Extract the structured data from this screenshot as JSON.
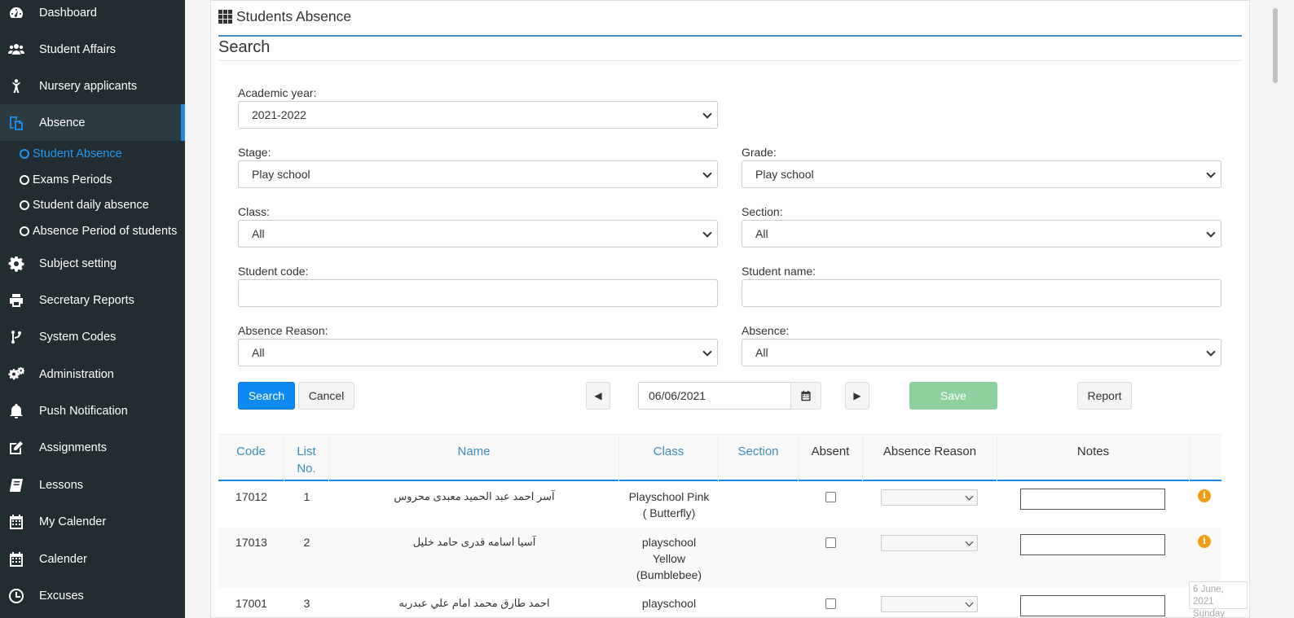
{
  "sidebar": {
    "items": [
      {
        "label": "Dashboard",
        "icon": "dashboard-icon"
      },
      {
        "label": "Student Affairs",
        "icon": "users-icon"
      },
      {
        "label": "Nursery applicants",
        "icon": "child-icon"
      },
      {
        "label": "Absence",
        "icon": "copy-icon",
        "active": true
      },
      {
        "label": "Subject setting",
        "icon": "gear-icon"
      },
      {
        "label": "Secretary Reports",
        "icon": "print-icon"
      },
      {
        "label": "System Codes",
        "icon": "code-fork-icon"
      },
      {
        "label": "Administration",
        "icon": "gears-icon"
      },
      {
        "label": "Push Notification",
        "icon": "bell-icon"
      },
      {
        "label": "Assignments",
        "icon": "edit-icon"
      },
      {
        "label": "Lessons",
        "icon": "book-icon"
      },
      {
        "label": "My Calender",
        "icon": "calendar-icon"
      },
      {
        "label": "Calender",
        "icon": "calendar-icon"
      },
      {
        "label": "Excuses",
        "icon": "clock-icon"
      }
    ],
    "subitems": [
      {
        "label": "Student Absence",
        "active": true
      },
      {
        "label": "Exams Periods"
      },
      {
        "label": "Student daily absence"
      },
      {
        "label": "Absence Period of students"
      }
    ]
  },
  "page": {
    "title": "Students Absence",
    "search_title": "Search"
  },
  "form": {
    "academic_year": {
      "label": "Academic year:",
      "value": "2021-2022"
    },
    "stage": {
      "label": "Stage:",
      "value": "Play school"
    },
    "grade": {
      "label": "Grade:",
      "value": "Play school"
    },
    "class": {
      "label": "Class:",
      "value": "All"
    },
    "section": {
      "label": "Section:",
      "value": "All"
    },
    "student_code": {
      "label": "Student code:",
      "value": ""
    },
    "student_name": {
      "label": "Student name:",
      "value": ""
    },
    "absence_reason": {
      "label": "Absence Reason:",
      "value": "All"
    },
    "absence": {
      "label": "Absence:",
      "value": "All"
    }
  },
  "actions": {
    "search": "Search",
    "cancel": "Cancel",
    "prev": "◀",
    "next": "▶",
    "date": "06/06/2021",
    "save": "Save",
    "report": "Report"
  },
  "table": {
    "headers": {
      "code": "Code",
      "list_no_1": "List",
      "list_no_2": "No.",
      "name": "Name",
      "class": "Class",
      "section": "Section",
      "absent": "Absent",
      "absence_reason": "Absence Reason",
      "notes": "Notes"
    },
    "rows": [
      {
        "code": "17012",
        "list_no": "1",
        "name": "آسر احمد عبد الحميد معبدى محروس",
        "class_l1": "Playschool Pink",
        "class_l2": "( Butterfly)",
        "class_l3": ""
      },
      {
        "code": "17013",
        "list_no": "2",
        "name": "آسيا اسامه قدرى حامد خليل",
        "class_l1": "playschool",
        "class_l2": "Yellow",
        "class_l3": "(Bumblebee)"
      },
      {
        "code": "17001",
        "list_no": "3",
        "name": "احمد طارق محمد امام علي عبدربه",
        "class_l1": "playschool",
        "class_l2": "",
        "class_l3": ""
      }
    ]
  },
  "tooltip": {
    "line1": "6 June, 2021",
    "line2": "Sunday"
  },
  "colors": {
    "sidebar_bg": "#222d32",
    "accent": "#1e88e5",
    "primary_button": "#0d8af2",
    "save_button": "#8fd19e",
    "info_icon": "#f39c12"
  }
}
